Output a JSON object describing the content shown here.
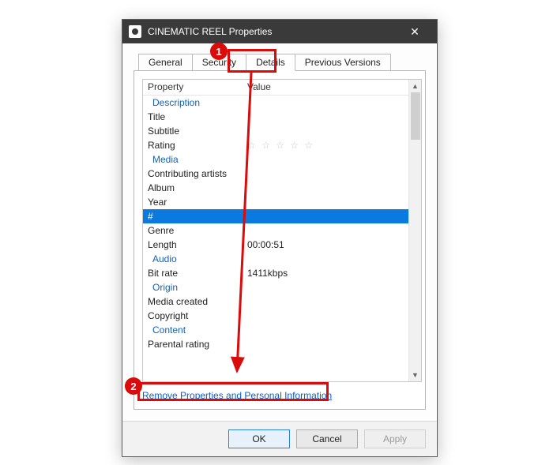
{
  "window": {
    "title": "CINEMATIC REEL Properties",
    "close_glyph": "✕"
  },
  "tabs": {
    "general": "General",
    "security": "Security",
    "details": "Details",
    "previous": "Previous Versions"
  },
  "grid": {
    "header_property": "Property",
    "header_value": "Value",
    "sections": {
      "description": "Description",
      "media": "Media",
      "audio": "Audio",
      "origin": "Origin",
      "content": "Content"
    },
    "rows": {
      "title": "Title",
      "subtitle": "Subtitle",
      "rating": "Rating",
      "rating_value": "☆ ☆ ☆ ☆ ☆",
      "contrib": "Contributing artists",
      "album": "Album",
      "year": "Year",
      "track": "#",
      "genre": "Genre",
      "length": "Length",
      "length_value": "00:00:51",
      "bitrate": "Bit rate",
      "bitrate_value": "1411kbps",
      "media_created": "Media created",
      "copyright": "Copyright",
      "parental": "Parental rating"
    }
  },
  "link": {
    "remove": "Remove Properties and Personal Information"
  },
  "buttons": {
    "ok": "OK",
    "cancel": "Cancel",
    "apply": "Apply"
  },
  "annotations": {
    "badge1": "1",
    "badge2": "2"
  },
  "scroll": {
    "up": "▲",
    "down": "▼"
  }
}
